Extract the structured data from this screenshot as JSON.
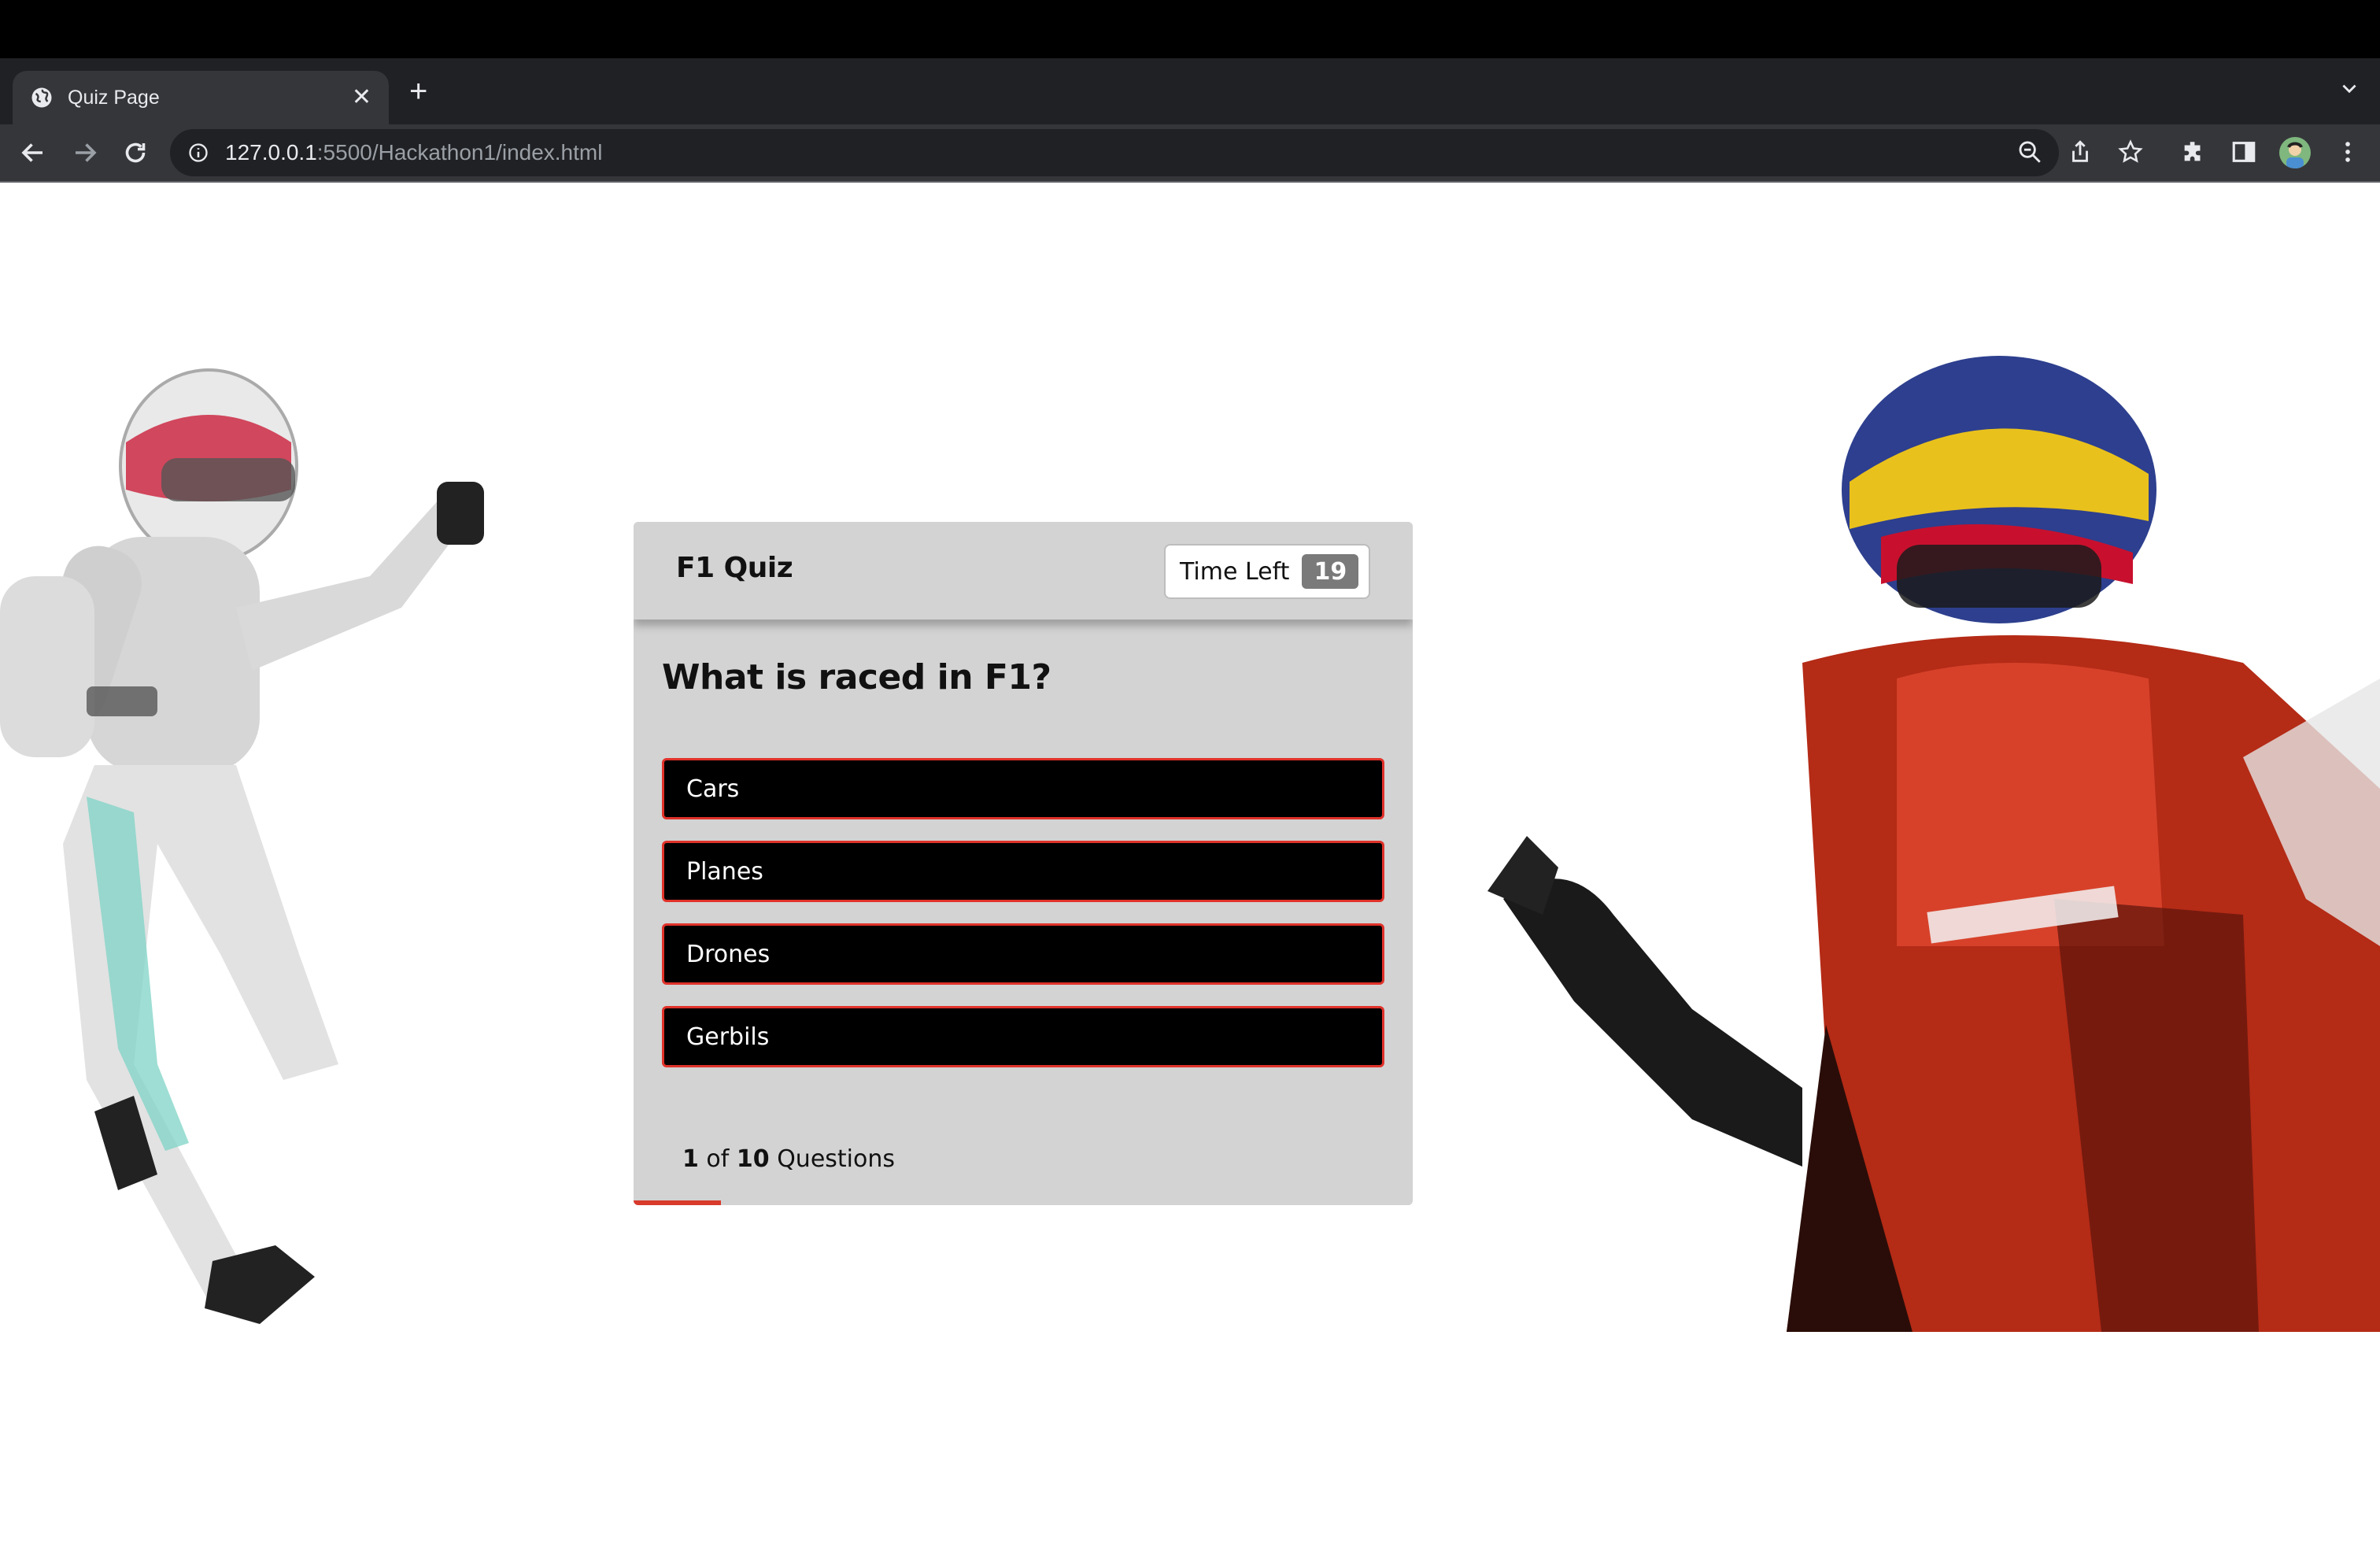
{
  "browser": {
    "tab_title": "Quiz Page",
    "url_host": "127.0.0.1",
    "url_rest": ":5500/Hackathon1/index.html"
  },
  "quiz": {
    "title": "F1 Quiz",
    "timer_label": "Time Left",
    "timer_value": "19",
    "question": "What is raced in F1?",
    "options": [
      "Cars",
      "Planes",
      "Drones",
      "Gerbils"
    ],
    "progress": {
      "current": "1",
      "of_text": "of",
      "total": "10",
      "suffix": "Questions",
      "fraction": 0.1
    },
    "colors": {
      "accent": "#d83a2c",
      "option_bg": "#000000",
      "panel_bg": "#d3d3d3"
    }
  },
  "images": {
    "left": "racing-driver-white-suit",
    "right": "racing-driver-red-suit"
  }
}
